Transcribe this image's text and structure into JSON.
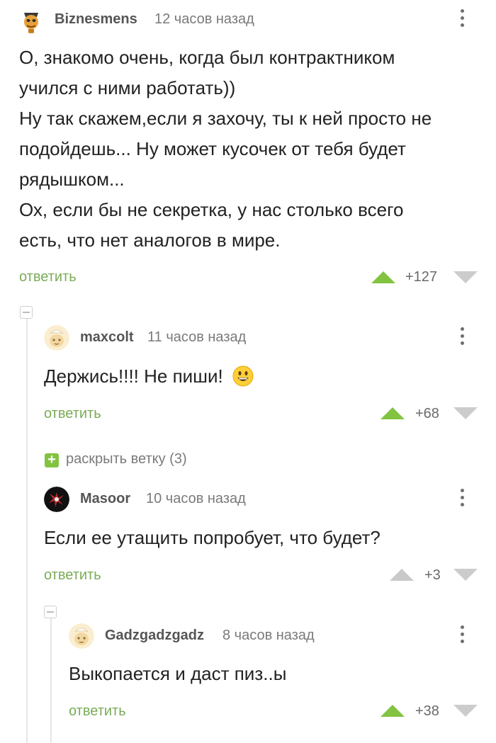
{
  "comments": [
    {
      "author": "Biznesmens",
      "time": "12 часов назад",
      "lines": [
        "О, знакомо очень, когда был контрактником",
        "учился с ними работать))",
        "Ну так скажем,если я захочу, ты к ней просто не",
        "подойдешь... Ну может кусочек от тебя будет",
        "рядышком...",
        "Ох, если бы не секретка, у нас столько всего",
        "есть, что нет аналогов в мире."
      ],
      "reply_label": "ответить",
      "score": "+127"
    },
    {
      "author": "maxcolt",
      "time": "11 часов назад",
      "text": "Держись!!!! Не пиши!",
      "reply_label": "ответить",
      "score": "+68"
    },
    {
      "author": "Masoor",
      "time": "10 часов назад",
      "text": "Если ее утащить попробует, что будет?",
      "reply_label": "ответить",
      "score": "+3"
    },
    {
      "author": "Gadzgadzgadz",
      "time": "8 часов назад",
      "text": "Выкопается и даст пиз..ы",
      "reply_label": "ответить",
      "score": "+38"
    }
  ],
  "expand_branch": {
    "label": "раскрыть ветку (3)",
    "icon": "plus-icon"
  },
  "colors": {
    "accent_green": "#82c341",
    "reply_green": "#7aab57",
    "muted": "#7a7a7a"
  }
}
